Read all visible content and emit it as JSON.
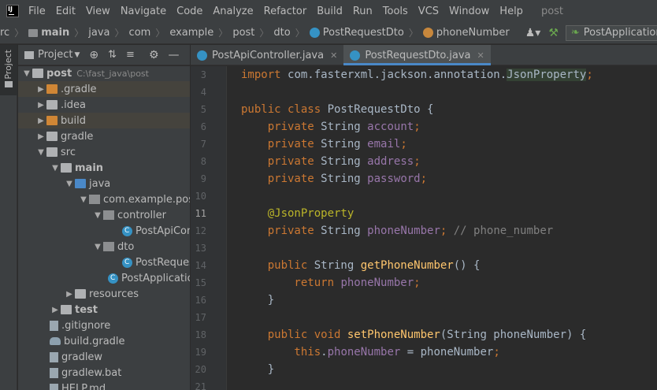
{
  "menubar": {
    "items": [
      "File",
      "Edit",
      "View",
      "Navigate",
      "Code",
      "Analyze",
      "Refactor",
      "Build",
      "Run",
      "Tools",
      "VCS",
      "Window",
      "Help"
    ],
    "project": "post"
  },
  "navbar": {
    "crumbs": [
      "rc",
      "main",
      "java",
      "com",
      "example",
      "post",
      "dto",
      "PostRequestDto",
      "phoneNumber"
    ],
    "run_config": "PostApplication"
  },
  "strip": {
    "label": "Project"
  },
  "project_panel": {
    "title": "Project",
    "tree": [
      {
        "label": "post",
        "path": "C:\\fast_java\\post"
      },
      {
        "label": ".gradle"
      },
      {
        "label": ".idea"
      },
      {
        "label": "build"
      },
      {
        "label": "gradle"
      },
      {
        "label": "src"
      },
      {
        "label": "main"
      },
      {
        "label": "java"
      },
      {
        "label": "com.example.post"
      },
      {
        "label": "controller"
      },
      {
        "label": "PostApiCont"
      },
      {
        "label": "dto"
      },
      {
        "label": "PostRequestI"
      },
      {
        "label": "PostApplication"
      },
      {
        "label": "resources"
      },
      {
        "label": "test"
      },
      {
        "label": ".gitignore"
      },
      {
        "label": "build.gradle"
      },
      {
        "label": "gradlew"
      },
      {
        "label": "gradlew.bat"
      },
      {
        "label": "HELP.md"
      }
    ]
  },
  "editor": {
    "tabs": [
      {
        "label": "PostApiController.java",
        "active": false
      },
      {
        "label": "PostRequestDto.java",
        "active": true
      }
    ],
    "lines": [
      {
        "num": "3",
        "code": "import com.fasterxml.jackson.annotation.JsonProperty;"
      },
      {
        "num": "4",
        "code": ""
      },
      {
        "num": "5",
        "code": "public class PostRequestDto {"
      },
      {
        "num": "6",
        "code": "    private String account;"
      },
      {
        "num": "7",
        "code": "    private String email;"
      },
      {
        "num": "8",
        "code": "    private String address;"
      },
      {
        "num": "9",
        "code": "    private String password;"
      },
      {
        "num": "10",
        "code": ""
      },
      {
        "num": "11",
        "code": "    @JsonProperty"
      },
      {
        "num": "12",
        "code": "    private String phoneNumber; // phone_number"
      },
      {
        "num": "13",
        "code": ""
      },
      {
        "num": "14",
        "code": "    public String getPhoneNumber() {"
      },
      {
        "num": "15",
        "code": "        return phoneNumber;"
      },
      {
        "num": "16",
        "code": "    }"
      },
      {
        "num": "17",
        "code": ""
      },
      {
        "num": "18",
        "code": "    public void setPhoneNumber(String phoneNumber) {"
      },
      {
        "num": "19",
        "code": "        this.phoneNumber = phoneNumber;"
      },
      {
        "num": "20",
        "code": "    }"
      },
      {
        "num": "21",
        "code": ""
      }
    ]
  }
}
